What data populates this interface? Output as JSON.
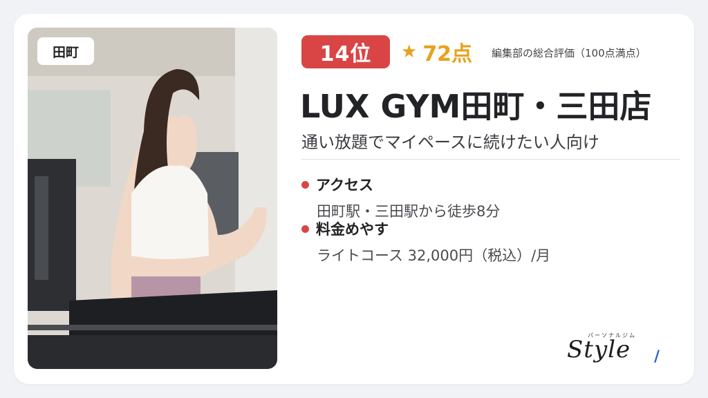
{
  "location_badge": "田町",
  "rank": "14位",
  "rating": {
    "star_icon": "star-icon",
    "value": "72点",
    "note": "編集部の総合評価（100点満点）"
  },
  "gym": {
    "name": "LUX GYM田町・三田店",
    "tagline": "通い放題でマイペースに続けたい人向け"
  },
  "info": [
    {
      "label": "アクセス",
      "value": "田町駅・三田駅から徒歩8分"
    },
    {
      "label": "料金めやす",
      "value": "ライトコース 32,000円（税込）/月"
    }
  ],
  "logo": {
    "kana": "パーソナルジム",
    "word": "Style"
  },
  "colors": {
    "accent_red": "#d94545",
    "star_gold": "#e7a21c",
    "logo_blue": "#2b5fd9"
  }
}
